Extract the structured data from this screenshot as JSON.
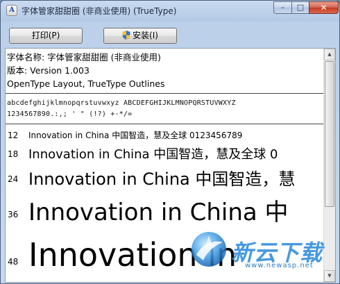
{
  "window": {
    "title": "字体管家甜甜圈 (非商业使用) (TrueType)",
    "app_icon_glyph": "A",
    "controls": {
      "minimize": "–",
      "maximize": "□",
      "close": "✕"
    }
  },
  "toolbar": {
    "print_label": "打印(P)",
    "install_label": "安装(I)"
  },
  "info": {
    "font_name": "字体名称: 字体管家甜甜圈 (非商业使用)",
    "version": "版本: Version 1.003",
    "outlines": "OpenType Layout, TrueType Outlines"
  },
  "charset": {
    "line1": "abcdefghijklmnopqrstuvwxyz ABCDEFGHIJKLMNOPQRSTUVWXYZ",
    "line2": "1234567890.:,; ' \" (!?) +-*/="
  },
  "samples": [
    {
      "size": "12",
      "text": "Innovation in China 中国智造，慧及全球 0123456789"
    },
    {
      "size": "18",
      "text": "Innovation in China 中国智造，慧及全球 0"
    },
    {
      "size": "24",
      "text": "Innovation in China 中国智造，慧"
    },
    {
      "size": "36",
      "text": "Innovation in China 中"
    },
    {
      "size": "48",
      "text": "Innovation in"
    }
  ],
  "watermark": {
    "brand": "新云下载",
    "url": "www.newasp.net"
  },
  "colors": {
    "titlebar": "#b9cde8",
    "accent": "#2d8bdb",
    "close": "#c5391f"
  }
}
